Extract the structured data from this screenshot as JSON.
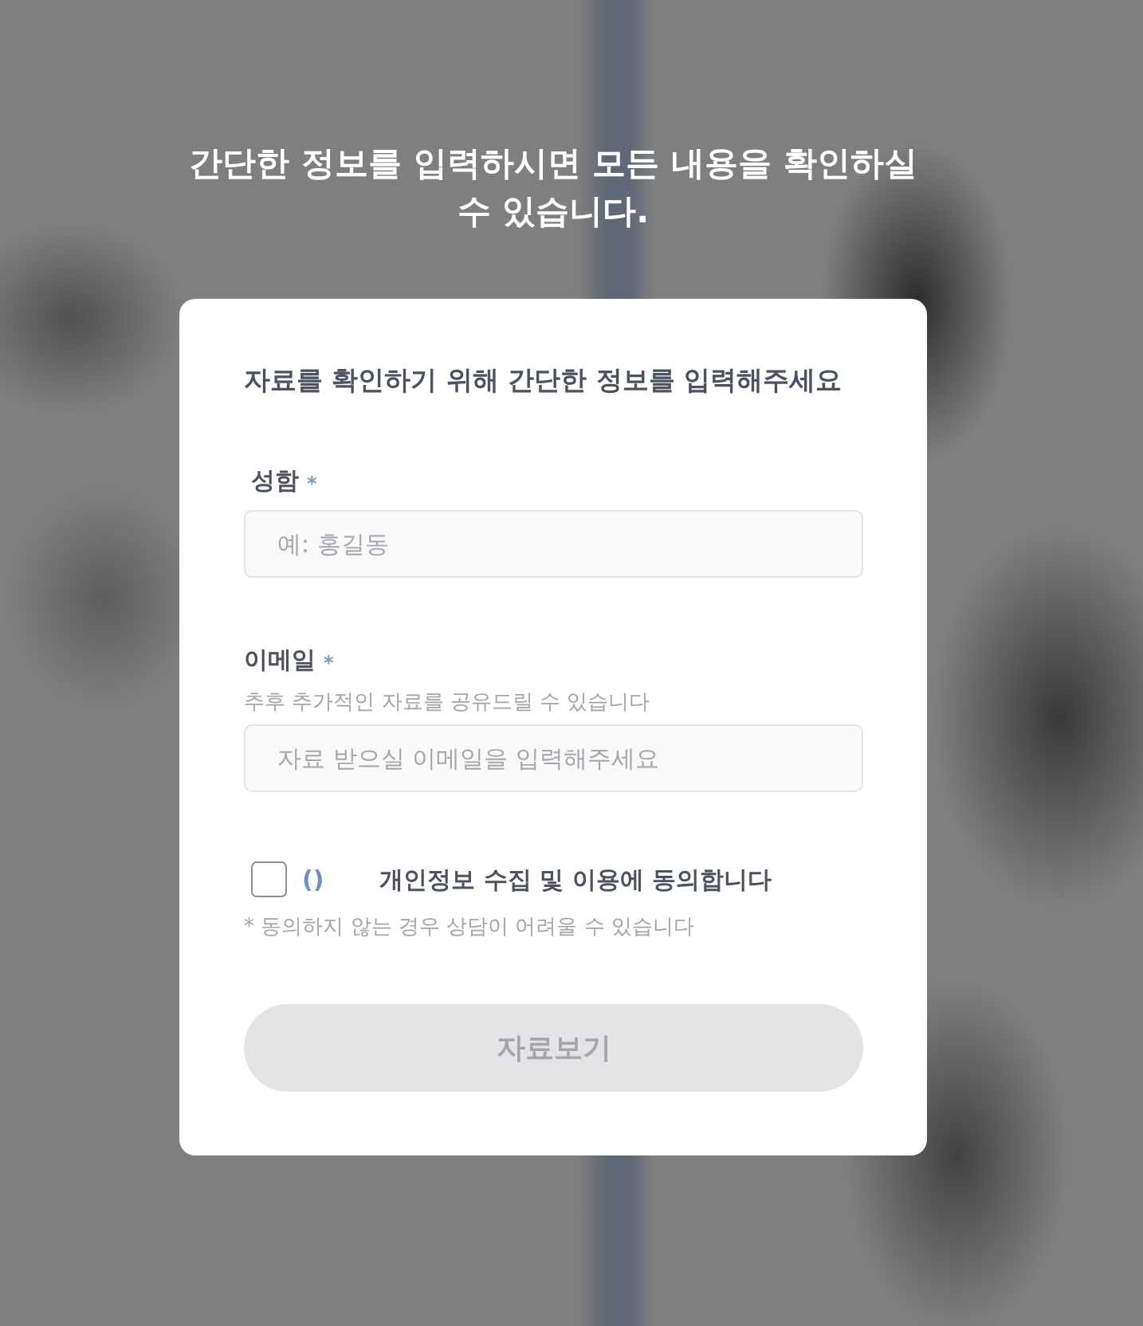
{
  "headline": "간단한 정보를 입력하시면 모든 내용을 확인하실 수 있습니다.",
  "form": {
    "title": "자료를 확인하기 위해 간단한 정보를 입력해주세요",
    "fields": [
      {
        "label": "성함",
        "required_mark": "*",
        "placeholder": "예: 홍길동"
      },
      {
        "label": "이메일",
        "required_mark": "*",
        "hint": "추후 추가적인 자료를 공유드릴 수 있습니다",
        "placeholder": "자료 받으실 이메일을 입력해주세요"
      }
    ],
    "consent": {
      "checked": false,
      "badge": "()",
      "label": "개인정보 수집 및 이용에 동의합니다",
      "note": "* 동의하지 않는 경우 상담이 어려울 수 있습니다"
    },
    "submit": {
      "label": "자료보기",
      "disabled": true
    }
  }
}
